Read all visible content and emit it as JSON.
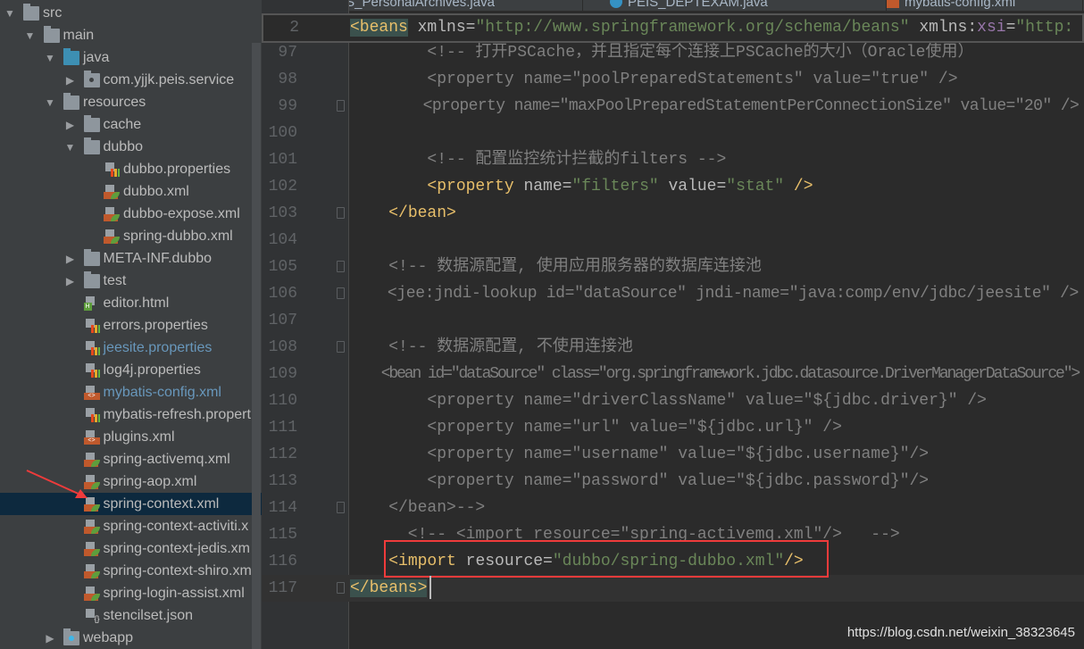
{
  "sidebar": {
    "items": [
      {
        "label": "src",
        "level": 0,
        "arrow": "down",
        "icon": "folder"
      },
      {
        "label": "main",
        "level": 1,
        "arrow": "down",
        "icon": "folder"
      },
      {
        "label": "java",
        "level": 2,
        "arrow": "down",
        "icon": "folder-source"
      },
      {
        "label": "com.yjjk.peis.service",
        "level": 3,
        "arrow": "right",
        "icon": "package"
      },
      {
        "label": "resources",
        "level": 2,
        "arrow": "down",
        "icon": "folder-resources"
      },
      {
        "label": "cache",
        "level": 3,
        "arrow": "right",
        "icon": "folder"
      },
      {
        "label": "dubbo",
        "level": 3,
        "arrow": "down",
        "icon": "folder"
      },
      {
        "label": "dubbo.properties",
        "level": 4,
        "icon": "properties-file"
      },
      {
        "label": "dubbo.xml",
        "level": 4,
        "icon": "spring-xml-file"
      },
      {
        "label": "dubbo-expose.xml",
        "level": 4,
        "icon": "spring-xml-file"
      },
      {
        "label": "spring-dubbo.xml",
        "level": 4,
        "icon": "spring-xml-file"
      },
      {
        "label": "META-INF.dubbo",
        "level": 3,
        "arrow": "right",
        "icon": "folder"
      },
      {
        "label": "test",
        "level": 3,
        "arrow": "right",
        "icon": "folder"
      },
      {
        "label": "editor.html",
        "level": 3.9,
        "icon": "html-file"
      },
      {
        "label": "errors.properties",
        "level": 3.9,
        "icon": "properties-file"
      },
      {
        "label": "jeesite.properties",
        "level": 3.9,
        "icon": "properties-file",
        "modified": true
      },
      {
        "label": "log4j.properties",
        "level": 3.9,
        "icon": "properties-file"
      },
      {
        "label": "mybatis-config.xml",
        "level": 3.9,
        "icon": "xml-file",
        "modified": true
      },
      {
        "label": "mybatis-refresh.propert",
        "level": 3.9,
        "icon": "properties-file"
      },
      {
        "label": "plugins.xml",
        "level": 3.9,
        "icon": "xml-file"
      },
      {
        "label": "spring-activemq.xml",
        "level": 3.9,
        "icon": "spring-xml-file"
      },
      {
        "label": "spring-aop.xml",
        "level": 3.9,
        "icon": "spring-xml-file"
      },
      {
        "label": "spring-context.xml",
        "level": 3.9,
        "icon": "spring-xml-file",
        "selected": true
      },
      {
        "label": "spring-context-activiti.x",
        "level": 3.9,
        "icon": "spring-xml-file"
      },
      {
        "label": "spring-context-jedis.xm",
        "level": 3.9,
        "icon": "spring-xml-file"
      },
      {
        "label": "spring-context-shiro.xm",
        "level": 3.9,
        "icon": "spring-xml-file"
      },
      {
        "label": "spring-login-assist.xml",
        "level": 3.9,
        "icon": "spring-xml-file"
      },
      {
        "label": "stencilset.json",
        "level": 3.9,
        "icon": "json-file"
      },
      {
        "label": "webapp",
        "level": 2,
        "arrow": "right",
        "icon": "folder-web"
      }
    ]
  },
  "tabs": [
    {
      "label": "PEIS_PersonalArchives.java",
      "icon": "java-class"
    },
    {
      "label": "PEIS_DEPTEXAM.java",
      "icon": "java-class"
    },
    {
      "label": "mybatis-config.xml",
      "icon": "xml-file"
    }
  ],
  "sticky_line": {
    "number": "2",
    "tokens": [
      [
        "<beans",
        "t"
      ],
      [
        " xmlns=",
        "a"
      ],
      [
        "\"http://www.springframework.org/schema/beans\"",
        "s"
      ],
      [
        " xmlns:",
        "a"
      ],
      [
        "xsi",
        "x"
      ],
      [
        "=",
        "a"
      ],
      [
        "\"http:",
        "s"
      ]
    ]
  },
  "code_lines": [
    {
      "number": "97",
      "tokens": [
        [
          "        <!-- 打开PSCache，并且指定每个连接上PSCache的大小（Oracle使用）",
          "c"
        ]
      ]
    },
    {
      "number": "98",
      "tokens": [
        [
          "        <property name=\"poolPreparedStatements\" value=\"true\" />",
          "c"
        ]
      ]
    },
    {
      "number": "99",
      "fold": true,
      "tokens": [
        [
          "        <property name=\"maxPoolPreparedStatementPerConnectionSize\" value=\"20\" />",
          "c"
        ]
      ]
    },
    {
      "number": "100",
      "tokens": []
    },
    {
      "number": "101",
      "tokens": [
        [
          "        <!-- 配置监控统计拦截的filters -->",
          "c"
        ]
      ]
    },
    {
      "number": "102",
      "tokens": [
        [
          "        ",
          " "
        ],
        [
          "<property",
          "t"
        ],
        [
          " name=",
          "a"
        ],
        [
          "\"filters\"",
          "s"
        ],
        [
          " value=",
          "a"
        ],
        [
          "\"stat\"",
          "s"
        ],
        [
          " />",
          "t"
        ]
      ]
    },
    {
      "number": "103",
      "fold": true,
      "tokens": [
        [
          "    ",
          " "
        ],
        [
          "</bean>",
          "t"
        ]
      ]
    },
    {
      "number": "104",
      "tokens": []
    },
    {
      "number": "105",
      "fold": true,
      "tokens": [
        [
          "    <!-- 数据源配置, 使用应用服务器的数据库连接池",
          "c"
        ]
      ]
    },
    {
      "number": "106",
      "fold": true,
      "tokens": [
        [
          "    <jee:jndi-lookup id=\"dataSource\" jndi-name=\"java:comp/env/jdbc/jeesite\" />",
          "c"
        ]
      ]
    },
    {
      "number": "107",
      "tokens": []
    },
    {
      "number": "108",
      "fold": true,
      "tokens": [
        [
          "    <!-- 数据源配置, 不使用连接池",
          "c"
        ]
      ]
    },
    {
      "number": "109",
      "tokens": [
        [
          "    <bean id=\"dataSource\" class=\"org.springframework.jdbc.datasource.DriverManagerDataSource\">",
          "c"
        ]
      ]
    },
    {
      "number": "110",
      "tokens": [
        [
          "        <property name=\"driverClassName\" value=\"${jdbc.driver}\" />",
          "c"
        ]
      ]
    },
    {
      "number": "111",
      "tokens": [
        [
          "        <property name=\"url\" value=\"${jdbc.url}\" />",
          "c"
        ]
      ]
    },
    {
      "number": "112",
      "tokens": [
        [
          "        <property name=\"username\" value=\"${jdbc.username}\"/>",
          "c"
        ]
      ]
    },
    {
      "number": "113",
      "tokens": [
        [
          "        <property name=\"password\" value=\"${jdbc.password}\"/>",
          "c"
        ]
      ]
    },
    {
      "number": "114",
      "fold": true,
      "tokens": [
        [
          "    </bean>-->",
          "c"
        ]
      ]
    },
    {
      "number": "115",
      "tokens": [
        [
          "      <!-- <import resource=\"spring-activemq.xml\"/>   -->",
          "c"
        ]
      ]
    },
    {
      "number": "116",
      "tokens": [
        [
          "    ",
          " "
        ],
        [
          "<import",
          "t"
        ],
        [
          " resource=",
          "a"
        ],
        [
          "\"dubbo/spring-dubbo.xml\"",
          "s"
        ],
        [
          "/>",
          "t"
        ]
      ]
    },
    {
      "number": "117",
      "fold": true,
      "current": true,
      "tokens": [
        [
          "</beans>",
          "t match"
        ]
      ]
    }
  ],
  "watermark": "https://blog.csdn.net/weixin_38323645",
  "colors": {
    "tag": "#e8bf6a",
    "attribute": "#bababa",
    "string": "#6a8759",
    "comment": "#808080",
    "selection": "#0d293e",
    "highlight_box": "#ef3b3b"
  }
}
